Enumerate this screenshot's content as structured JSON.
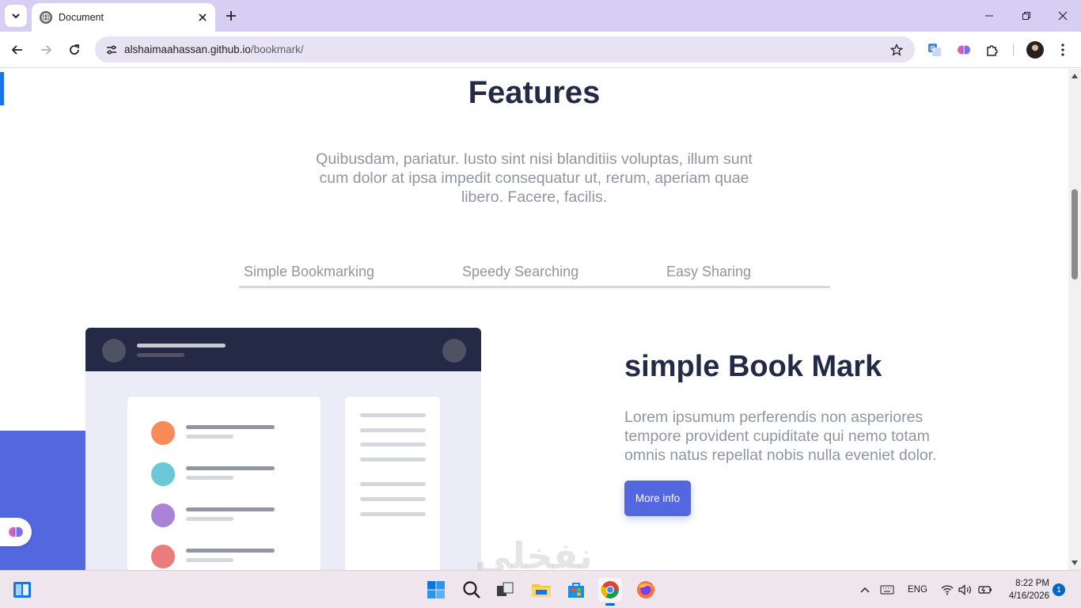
{
  "browser": {
    "tab_title": "Document",
    "url_host": "alshaimaahassan.github.io",
    "url_path": "/bookmark/"
  },
  "page": {
    "heading": "Features",
    "intro": "Quibusdam, pariatur. Iusto sint nisi blanditiis voluptas, illum sunt cum dolor at ipsa impedit consequatur ut, rerum, aperiam quae libero. Facere, facilis.",
    "tabs": [
      {
        "label": "Simple Bookmarking"
      },
      {
        "label": "Speedy Searching"
      },
      {
        "label": "Easy Sharing"
      }
    ],
    "feature": {
      "title": "simple Book Mark",
      "text": "Lorem ipsumum perferendis non asperiores tempore provident cupiditate qui nemo totam omnis natus repellat nobis nulla eveniet dolor.",
      "button": "More info"
    },
    "watermark": "نفخلي"
  },
  "colors": {
    "primary": "#5368df",
    "dark_blue": "#242a45",
    "grey_text": "#9194a2",
    "dot_orange": "#f98b59",
    "dot_cyan": "#6bc9d7",
    "dot_purple": "#a983d7",
    "dot_red": "#ec7b7b"
  },
  "taskbar": {
    "language": "ENG",
    "time": "8:22 PM",
    "date": "4/16/2026",
    "notifications": "1"
  }
}
